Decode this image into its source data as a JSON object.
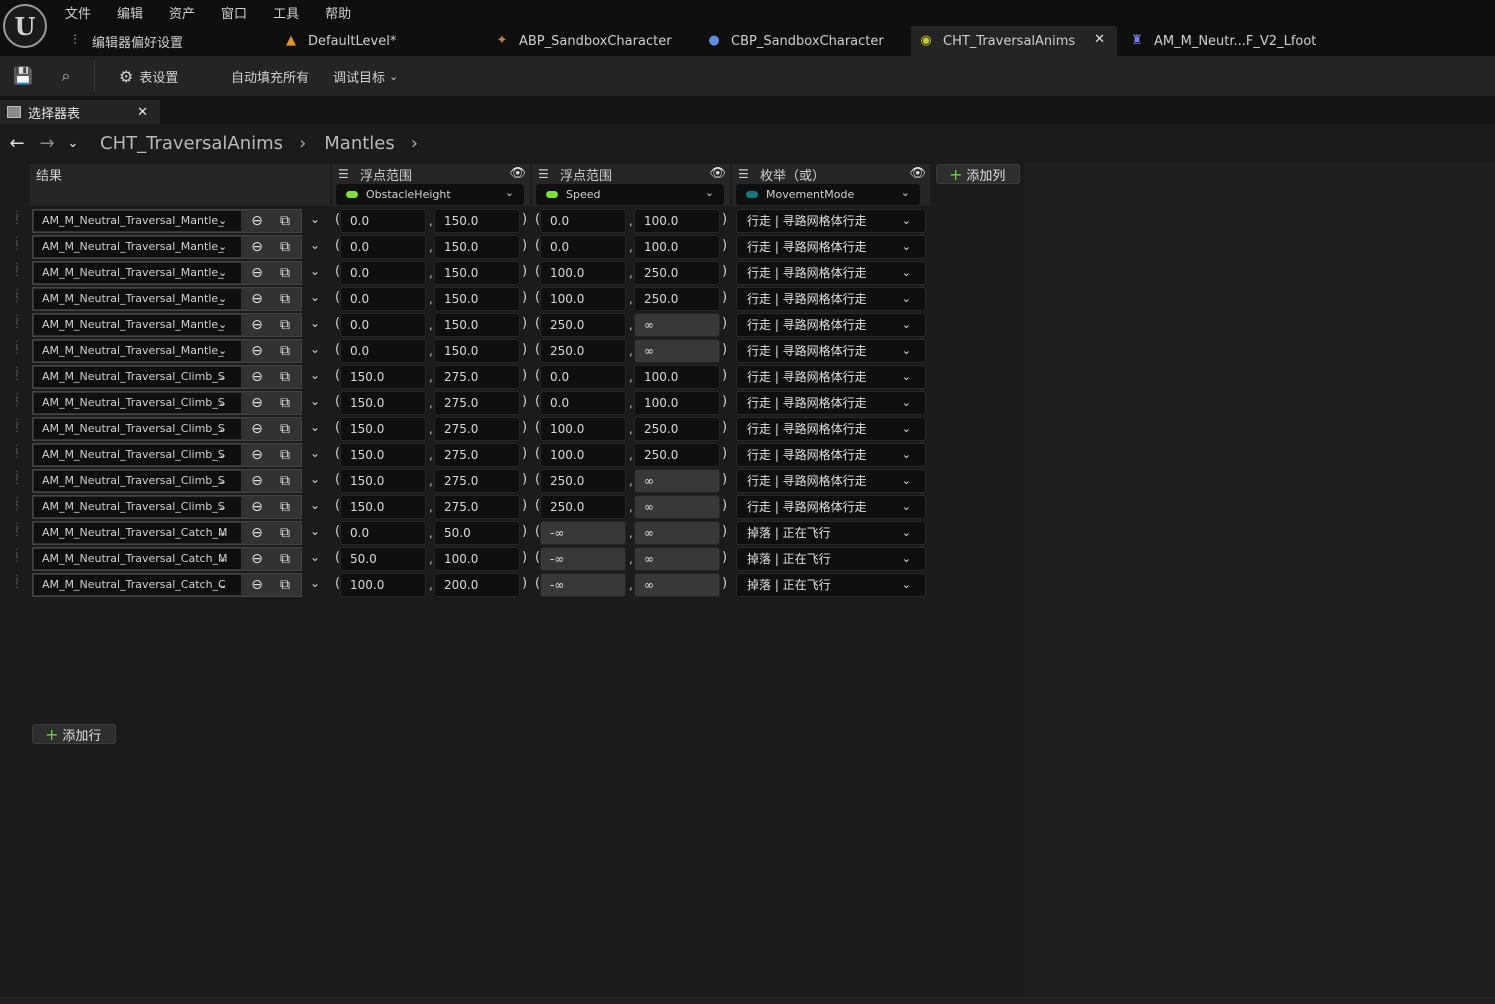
{
  "menu": [
    "文件",
    "编辑",
    "资产",
    "窗口",
    "工具",
    "帮助"
  ],
  "tabs": [
    {
      "label": "编辑器偏好设置",
      "icon": "sliders-icon"
    },
    {
      "label": "DefaultLevel*",
      "icon": "level-icon"
    },
    {
      "label": "ABP_SandboxCharacter",
      "icon": "anim-blueprint-icon"
    },
    {
      "label": "CBP_SandboxCharacter",
      "icon": "character-icon"
    },
    {
      "label": "CHT_TraversalAnims",
      "icon": "chooser-table-icon",
      "active": true
    },
    {
      "label": "AM_M_Neutr...F_V2_Lfoot",
      "icon": "anim-montage-icon"
    }
  ],
  "toolbar": {
    "table_settings": "表设置",
    "autofill_all": "自动填充所有",
    "debug_target": "调试目标"
  },
  "panel_tab": {
    "label": "选择器表"
  },
  "breadcrumb": [
    "CHT_TraversalAnims",
    "Mantles"
  ],
  "columns": {
    "result": "结果",
    "col1": {
      "title": "浮点范围",
      "property": "ObstacleHeight",
      "color": "#7fe03a"
    },
    "col2": {
      "title": "浮点范围",
      "property": "Speed",
      "color": "#7fe03a"
    },
    "col3": {
      "title": "枚举（或）",
      "property": "MovementMode",
      "color": "#137a7a"
    },
    "add_column": "添加列"
  },
  "rows": [
    {
      "asset": "AM_M_Neutral_Traversal_Mantle_",
      "h_min": "0.0",
      "h_max": "150.0",
      "s_min": "0.0",
      "s_max": "100.0",
      "mode": "行走 | 寻路网格体行走"
    },
    {
      "asset": "AM_M_Neutral_Traversal_Mantle_",
      "h_min": "0.0",
      "h_max": "150.0",
      "s_min": "0.0",
      "s_max": "100.0",
      "mode": "行走 | 寻路网格体行走"
    },
    {
      "asset": "AM_M_Neutral_Traversal_Mantle_",
      "h_min": "0.0",
      "h_max": "150.0",
      "s_min": "100.0",
      "s_max": "250.0",
      "mode": "行走 | 寻路网格体行走"
    },
    {
      "asset": "AM_M_Neutral_Traversal_Mantle_",
      "h_min": "0.0",
      "h_max": "150.0",
      "s_min": "100.0",
      "s_max": "250.0",
      "mode": "行走 | 寻路网格体行走"
    },
    {
      "asset": "AM_M_Neutral_Traversal_Mantle_",
      "h_min": "0.0",
      "h_max": "150.0",
      "s_min": "250.0",
      "s_max": "∞",
      "mode": "行走 | 寻路网格体行走"
    },
    {
      "asset": "AM_M_Neutral_Traversal_Mantle_",
      "h_min": "0.0",
      "h_max": "150.0",
      "s_min": "250.0",
      "s_max": "∞",
      "mode": "行走 | 寻路网格体行走"
    },
    {
      "asset": "AM_M_Neutral_Traversal_Climb_S",
      "h_min": "150.0",
      "h_max": "275.0",
      "s_min": "0.0",
      "s_max": "100.0",
      "mode": "行走 | 寻路网格体行走"
    },
    {
      "asset": "AM_M_Neutral_Traversal_Climb_S",
      "h_min": "150.0",
      "h_max": "275.0",
      "s_min": "0.0",
      "s_max": "100.0",
      "mode": "行走 | 寻路网格体行走"
    },
    {
      "asset": "AM_M_Neutral_Traversal_Climb_S",
      "h_min": "150.0",
      "h_max": "275.0",
      "s_min": "100.0",
      "s_max": "250.0",
      "mode": "行走 | 寻路网格体行走"
    },
    {
      "asset": "AM_M_Neutral_Traversal_Climb_S",
      "h_min": "150.0",
      "h_max": "275.0",
      "s_min": "100.0",
      "s_max": "250.0",
      "mode": "行走 | 寻路网格体行走"
    },
    {
      "asset": "AM_M_Neutral_Traversal_Climb_S",
      "h_min": "150.0",
      "h_max": "275.0",
      "s_min": "250.0",
      "s_max": "∞",
      "mode": "行走 | 寻路网格体行走"
    },
    {
      "asset": "AM_M_Neutral_Traversal_Climb_S",
      "h_min": "150.0",
      "h_max": "275.0",
      "s_min": "250.0",
      "s_max": "∞",
      "mode": "行走 | 寻路网格体行走"
    },
    {
      "asset": "AM_M_Neutral_Traversal_Catch_M",
      "h_min": "0.0",
      "h_max": "50.0",
      "s_min": "-∞",
      "s_max": "∞",
      "mode": "掉落 | 正在飞行"
    },
    {
      "asset": "AM_M_Neutral_Traversal_Catch_M",
      "h_min": "50.0",
      "h_max": "100.0",
      "s_min": "-∞",
      "s_max": "∞",
      "mode": "掉落 | 正在飞行"
    },
    {
      "asset": "AM_M_Neutral_Traversal_Catch_C",
      "h_min": "100.0",
      "h_max": "200.0",
      "s_min": "-∞",
      "s_max": "∞",
      "mode": "掉落 | 正在飞行"
    }
  ],
  "add_row": "添加行"
}
